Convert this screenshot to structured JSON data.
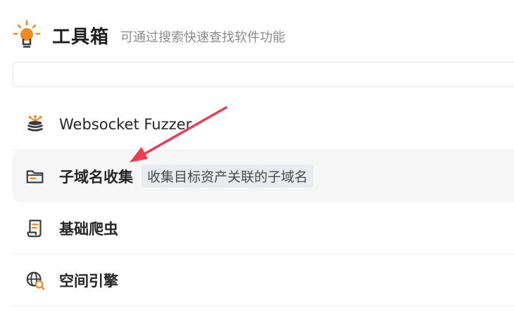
{
  "header": {
    "icon": "lightbulb-icon",
    "title": "工具箱",
    "subtitle": "可通过搜索快速查找软件功能"
  },
  "search": {
    "value": "",
    "placeholder": ""
  },
  "items": [
    {
      "label": "Websocket Fuzzer",
      "icon": "websocket-icon",
      "description": ""
    },
    {
      "label": "子域名收集",
      "icon": "folder-icon",
      "description": "收集目标资产关联的子域名"
    },
    {
      "label": "基础爬虫",
      "icon": "scroll-icon",
      "description": ""
    },
    {
      "label": "空间引擎",
      "icon": "globe-search-icon",
      "description": ""
    }
  ],
  "colors": {
    "accent": "#f28a1f",
    "icon": "#3a3d45",
    "annotation_arrow": "#ef3b55",
    "active_row": "#f6f6f7",
    "tag_bg": "#e9ebf0"
  }
}
